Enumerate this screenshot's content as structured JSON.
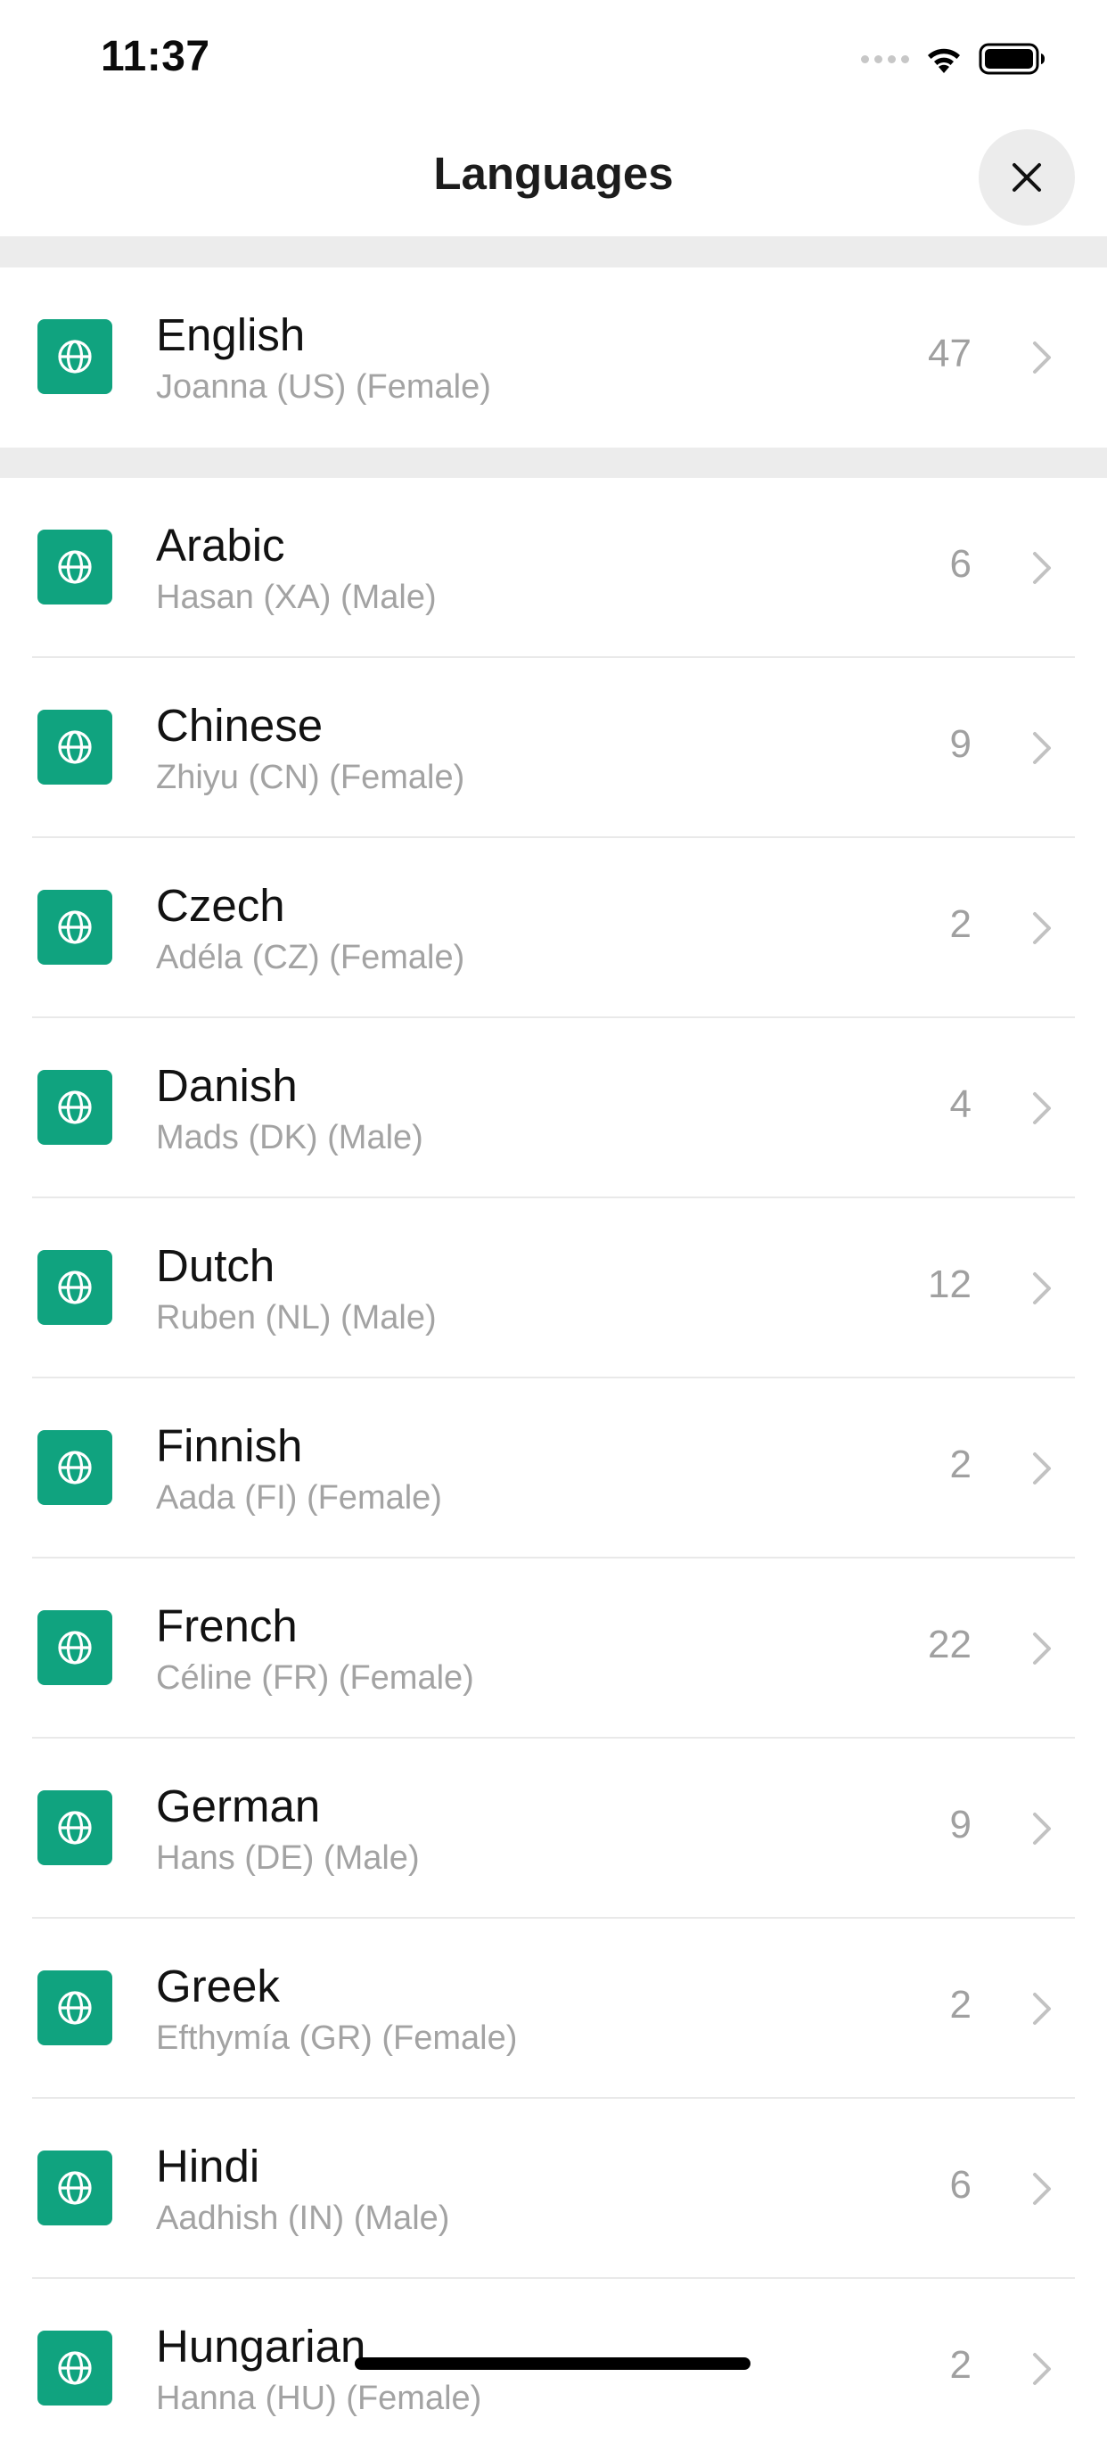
{
  "status_bar": {
    "time": "11:37"
  },
  "header": {
    "title": "Languages",
    "close_icon": "close-icon"
  },
  "featured": {
    "title": "English",
    "subtitle": "Joanna (US) (Female)",
    "count": "47",
    "icon": "globe-icon"
  },
  "languages": [
    {
      "title": "Arabic",
      "subtitle": "Hasan (XA) (Male)",
      "count": "6"
    },
    {
      "title": "Chinese",
      "subtitle": "Zhiyu (CN) (Female)",
      "count": "9"
    },
    {
      "title": "Czech",
      "subtitle": "Adéla (CZ) (Female)",
      "count": "2"
    },
    {
      "title": "Danish",
      "subtitle": "Mads (DK) (Male)",
      "count": "4"
    },
    {
      "title": "Dutch",
      "subtitle": "Ruben (NL) (Male)",
      "count": "12"
    },
    {
      "title": "Finnish",
      "subtitle": "Aada (FI) (Female)",
      "count": "2"
    },
    {
      "title": "French",
      "subtitle": "Céline (FR) (Female)",
      "count": "22"
    },
    {
      "title": "German",
      "subtitle": "Hans (DE) (Male)",
      "count": "9"
    },
    {
      "title": "Greek",
      "subtitle": "Efthymía (GR) (Female)",
      "count": "2"
    },
    {
      "title": "Hindi",
      "subtitle": "Aadhish (IN) (Male)",
      "count": "6"
    },
    {
      "title": "Hungarian",
      "subtitle": "Hanna (HU) (Female)",
      "count": "2"
    }
  ],
  "colors": {
    "accent": "#10a37f",
    "separator": "#ececec",
    "secondary_text": "#a3a3a3"
  }
}
